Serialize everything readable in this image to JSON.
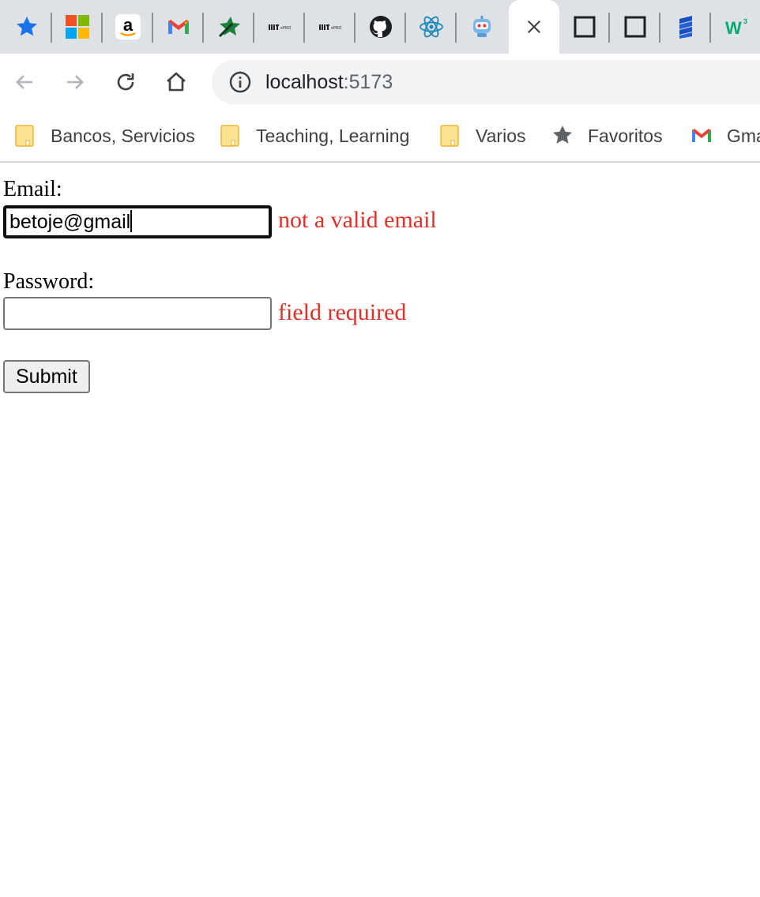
{
  "browser": {
    "tabs": [
      {
        "icon": "star-bookmark-icon"
      },
      {
        "icon": "microsoft-logo-icon"
      },
      {
        "icon": "amazon-logo-icon"
      },
      {
        "icon": "gmail-logo-icon"
      },
      {
        "icon": "green-star-arrow-icon"
      },
      {
        "icon": "mit-xpro-logo-icon"
      },
      {
        "icon": "mit-xpro-logo-icon"
      },
      {
        "icon": "github-logo-icon"
      },
      {
        "icon": "react-logo-icon"
      },
      {
        "icon": "robot-icon"
      },
      {
        "icon": "close-icon",
        "active": true
      },
      {
        "icon": "blank-page-icon"
      },
      {
        "icon": "blank-page-icon"
      },
      {
        "icon": "blue-stack-icon"
      },
      {
        "icon": "w3schools-logo-icon"
      }
    ],
    "address": {
      "host": "localhost",
      "port": ":5173"
    },
    "bookmarks": [
      {
        "label": "Bancos, Servicios",
        "icon": "folder-icon"
      },
      {
        "label": "Teaching, Learning",
        "icon": "folder-icon"
      },
      {
        "label": "Varios",
        "icon": "folder-icon"
      },
      {
        "label": "Favoritos",
        "icon": "star-icon"
      },
      {
        "label": "Gmail",
        "icon": "gmail-logo-icon"
      }
    ],
    "colors": {
      "tabstrip": "#dee1e6",
      "omnibox": "#f1f3f4",
      "folder": "#fbd46d"
    }
  },
  "form": {
    "email": {
      "label": "Email:",
      "value": "betoje@gmail",
      "error": "not a valid email"
    },
    "password": {
      "label": "Password:",
      "value": "",
      "error": "field required"
    },
    "submit_label": "Submit",
    "error_color": "#e0302a"
  }
}
